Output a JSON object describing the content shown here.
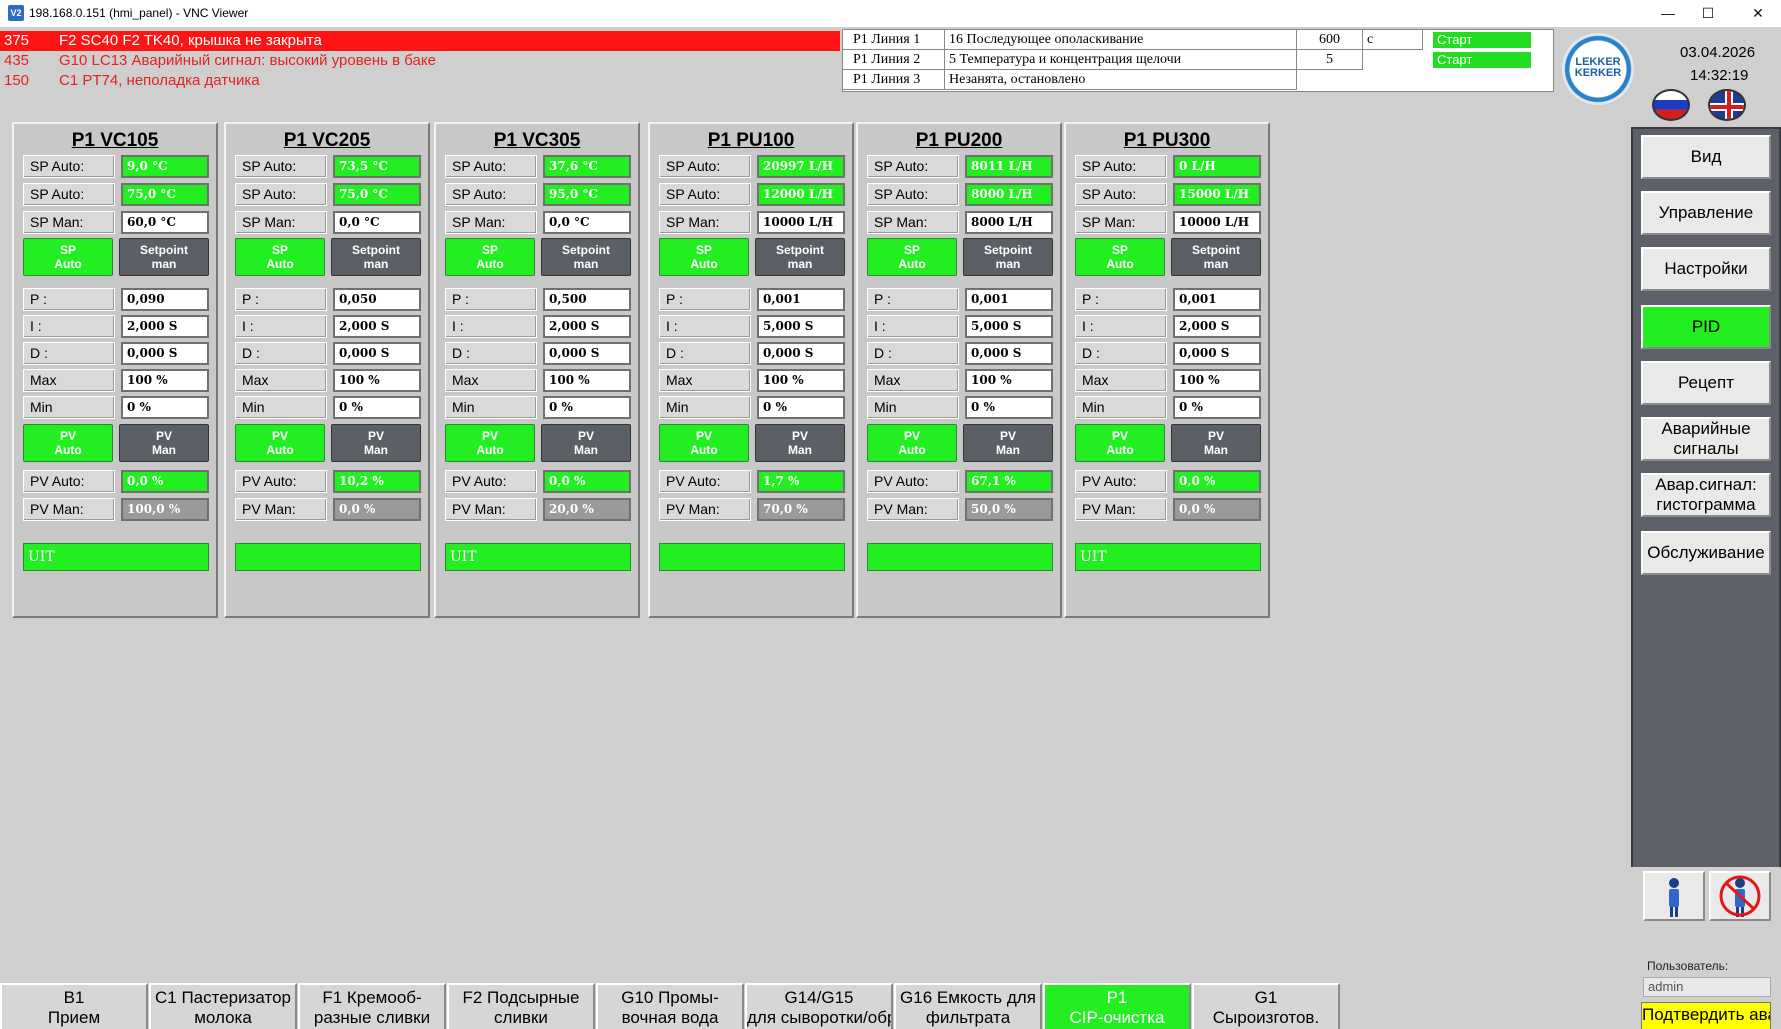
{
  "window": {
    "title": "198.168.0.151 (hmi_panel) - VNC Viewer",
    "app_icon": "V2",
    "minimize_glyph": "—",
    "maximize_glyph": "☐",
    "close_glyph": "✕"
  },
  "alarms": [
    {
      "code": "375",
      "text": "F2 SC40 F2 TK40, крышка не закрыта",
      "active": true
    },
    {
      "code": "435",
      "text": "G10 LC13 Аварийный сигнал: высокий уровень в баке",
      "active": false
    },
    {
      "code": "150",
      "text": "C1 PT74, неполадка датчика",
      "active": false
    }
  ],
  "lines": [
    {
      "line": "P1 Линия 1",
      "step": "16 Последующее ополаскивание",
      "value": "600",
      "unit": "с",
      "status": "Старт"
    },
    {
      "line": "P1 Линия 2",
      "step": "5 Температура и концентрация щелочи",
      "value": "5",
      "unit": "",
      "status": "Старт"
    },
    {
      "line": "P1 Линия 3",
      "step": "Незанята, остановлено",
      "value": "",
      "unit": "",
      "status": ""
    }
  ],
  "header": {
    "logo_line1": "LEKKER",
    "logo_line2": "KERKER",
    "date": "03.04.2026",
    "time": "14:32:19"
  },
  "labels": {
    "sp_auto": "SP Auto:",
    "sp_man": "SP Man:",
    "btn_sp_auto_1": "SP",
    "btn_sp_auto_2": "Auto",
    "btn_setpoint_1": "Setpoint",
    "btn_setpoint_2": "man",
    "p": "P :",
    "i": "I :",
    "d": "D :",
    "max": "Max",
    "min": "Min",
    "btn_pv_1": "PV",
    "btn_pv_auto_2": "Auto",
    "btn_pv_man_2": "Man",
    "pv_auto": "PV Auto:",
    "pv_man": "PV Man:"
  },
  "pid_panels": [
    {
      "title": "P1 VC105",
      "sp_auto_1": "9,0 °C",
      "sp_auto_2": "75,0 °C",
      "sp_man": "60,0 °C",
      "p": "0,090",
      "i": "2,000 S",
      "d": "0,000 S",
      "max": "100 %",
      "min": "0 %",
      "pv_auto": "0,0 %",
      "pv_man": "100,0 %",
      "status": "UIT"
    },
    {
      "title": "P1 VC205",
      "sp_auto_1": "73,5 °C",
      "sp_auto_2": "75,0 °C",
      "sp_man": "0,0 °C",
      "p": "0,050",
      "i": "2,000 S",
      "d": "0,000 S",
      "max": "100 %",
      "min": "0 %",
      "pv_auto": "10,2 %",
      "pv_man": "0,0 %",
      "status": ""
    },
    {
      "title": "P1 VC305",
      "sp_auto_1": "37,6 °C",
      "sp_auto_2": "95,0 °C",
      "sp_man": "0,0 °C",
      "p": "0,500",
      "i": "2,000 S",
      "d": "0,000 S",
      "max": "100 %",
      "min": "0 %",
      "pv_auto": "0,0 %",
      "pv_man": "20,0 %",
      "status": "UIT"
    },
    {
      "title": "P1 PU100",
      "sp_auto_1": "20997 L/H",
      "sp_auto_2": "12000 L/H",
      "sp_man": "10000 L/H",
      "p": "0,001",
      "i": "5,000 S",
      "d": "0,000 S",
      "max": "100 %",
      "min": "0 %",
      "pv_auto": "1,7 %",
      "pv_man": "70,0 %",
      "status": ""
    },
    {
      "title": "P1 PU200",
      "sp_auto_1": "8011 L/H",
      "sp_auto_2": "8000 L/H",
      "sp_man": "8000 L/H",
      "p": "0,001",
      "i": "5,000 S",
      "d": "0,000 S",
      "max": "100 %",
      "min": "0 %",
      "pv_auto": "67,1 %",
      "pv_man": "50,0 %",
      "status": ""
    },
    {
      "title": "P1 PU300",
      "sp_auto_1": "0 L/H",
      "sp_auto_2": "15000 L/H",
      "sp_man": "10000 L/H",
      "p": "0,001",
      "i": "2,000 S",
      "d": "0,000 S",
      "max": "100 %",
      "min": "0 %",
      "pv_auto": "0,0 %",
      "pv_man": "0,0 %",
      "status": "UIT"
    }
  ],
  "sidebar": {
    "items": [
      {
        "label": "Вид",
        "active": false
      },
      {
        "label": "Управление",
        "active": false
      },
      {
        "label": "Настройки",
        "active": false
      },
      {
        "label": "PID",
        "active": true
      },
      {
        "label": "Рецепт",
        "active": false
      },
      {
        "label": "Аварийные сигналы",
        "active": false
      },
      {
        "label": "Авар.сигнал: гистограмма",
        "active": false
      },
      {
        "label": "Обслуживание",
        "active": false
      }
    ],
    "user_label": "Пользователь:",
    "user_value": "admin",
    "confirm_label": "Подтвердить аварийный сигнал"
  },
  "tabs": [
    {
      "line1": "B1",
      "line2": "Прием",
      "active": false
    },
    {
      "line1": "C1 Пастеризатор",
      "line2": "молока",
      "active": false
    },
    {
      "line1": "F1 Кремооб-",
      "line2": "разные сливки",
      "active": false
    },
    {
      "line1": "F2 Подсырные",
      "line2": "сливки",
      "active": false
    },
    {
      "line1": "G10 Промы-",
      "line2": "вочная вода",
      "active": false
    },
    {
      "line1": "G14/G15",
      "line2": "для сыворотки/обр",
      "active": false
    },
    {
      "line1": "G16 Емкость для",
      "line2": "фильтрата",
      "active": false
    },
    {
      "line1": "P1",
      "line2": "CIP-очистка",
      "active": true
    },
    {
      "line1": "G1",
      "line2": "Сыроизготов.",
      "active": false
    }
  ]
}
